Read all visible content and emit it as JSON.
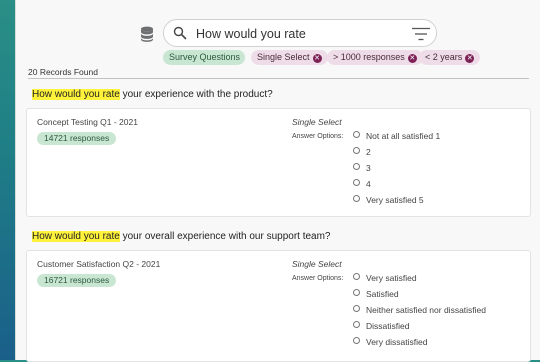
{
  "search": {
    "query": "How would you rate"
  },
  "filters": [
    {
      "label": "Survey Questions",
      "removable": false
    },
    {
      "label": "Single Select",
      "removable": true
    },
    {
      "label": "> 1000 responses",
      "removable": true
    },
    {
      "label": "< 2 years",
      "removable": true
    }
  ],
  "records_found": "20 Records Found",
  "results": [
    {
      "question_highlight": "How would you rate",
      "question_rest": " your experience with the product?",
      "survey": "Concept Testing Q1 - 2021",
      "responses": "14721 responses",
      "question_type": "Single Select",
      "answer_options_label": "Answer Options:",
      "options": [
        "Not at all satisfied 1",
        "2",
        "3",
        "4",
        "Very satisfied 5"
      ]
    },
    {
      "question_highlight": "How would you rate",
      "question_rest": " your overall experience with our support team?",
      "survey": "Customer Satisfaction Q2 - 2021",
      "responses": "16721 responses",
      "question_type": "Single Select",
      "answer_options_label": "Answer Options:",
      "options": [
        "Very satisfied",
        "Satisfied",
        "Neither satisfied nor dissatisfied",
        "Dissatisfied",
        "Very dissatisfied"
      ]
    }
  ],
  "colors": {
    "highlight": "#fff23a",
    "chip_green": "#c9e6d3",
    "chip_pink": "#eedde8",
    "chip_close": "#7c2256"
  },
  "icons": {
    "database": "database-icon",
    "search": "search-icon",
    "filter": "filter-icon",
    "close": "close-icon",
    "radio": "radio-icon"
  }
}
